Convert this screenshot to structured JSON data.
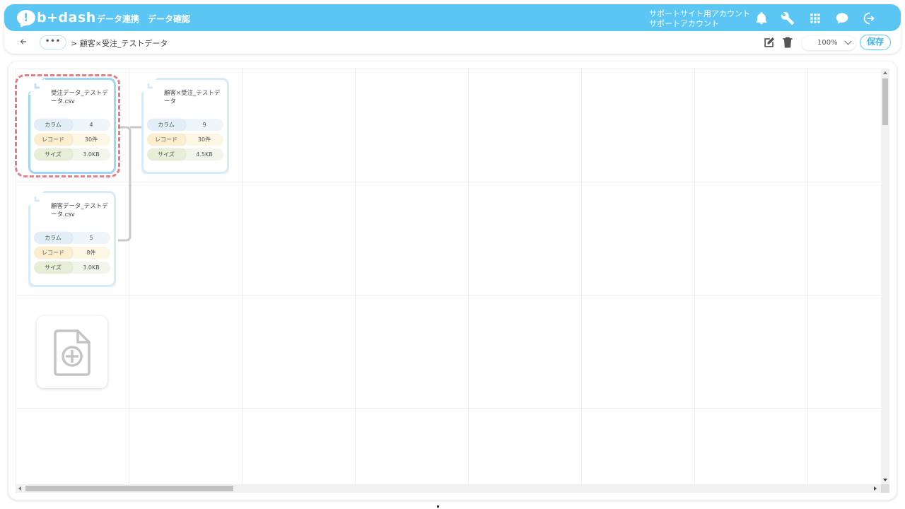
{
  "header": {
    "logo_text": "b+dash",
    "logo_mark": "!",
    "nav": [
      "データ連携",
      "データ確認"
    ],
    "account_line1": "サポートサイト用アカウント",
    "account_line2": "サポートアカウント",
    "icons": [
      "bell-icon",
      "wrench-icon",
      "grid-icon",
      "chat-icon",
      "logout-icon"
    ]
  },
  "toolbar": {
    "dots_label": "•••",
    "breadcrumb": "> 顧客×受注_テストデータ",
    "zoom_value": "100%",
    "save_label": "保存"
  },
  "cards": [
    {
      "title": "受注データ_テストデータ.csv",
      "selected": true,
      "rows": [
        {
          "label": "カラム",
          "value": "4"
        },
        {
          "label": "レコード",
          "value": "30件"
        },
        {
          "label": "サイズ",
          "value": "3.0KB"
        }
      ]
    },
    {
      "title": "顧客×受注_テストデータ",
      "selected": false,
      "rows": [
        {
          "label": "カラム",
          "value": "9"
        },
        {
          "label": "レコード",
          "value": "30件"
        },
        {
          "label": "サイズ",
          "value": "4.5KB"
        }
      ]
    },
    {
      "title": "顧客データ_テストデータ.csv",
      "selected": false,
      "rows": [
        {
          "label": "カラム",
          "value": "5"
        },
        {
          "label": "レコード",
          "value": "8件"
        },
        {
          "label": "サイズ",
          "value": "3.0KB"
        }
      ]
    }
  ],
  "colors": {
    "accent": "#5bc6f3",
    "selected_outline": "#ea7a85",
    "column_pill": "#e2eef8",
    "record_pill": "#fbefcf",
    "size_pill": "#e6eed6"
  }
}
